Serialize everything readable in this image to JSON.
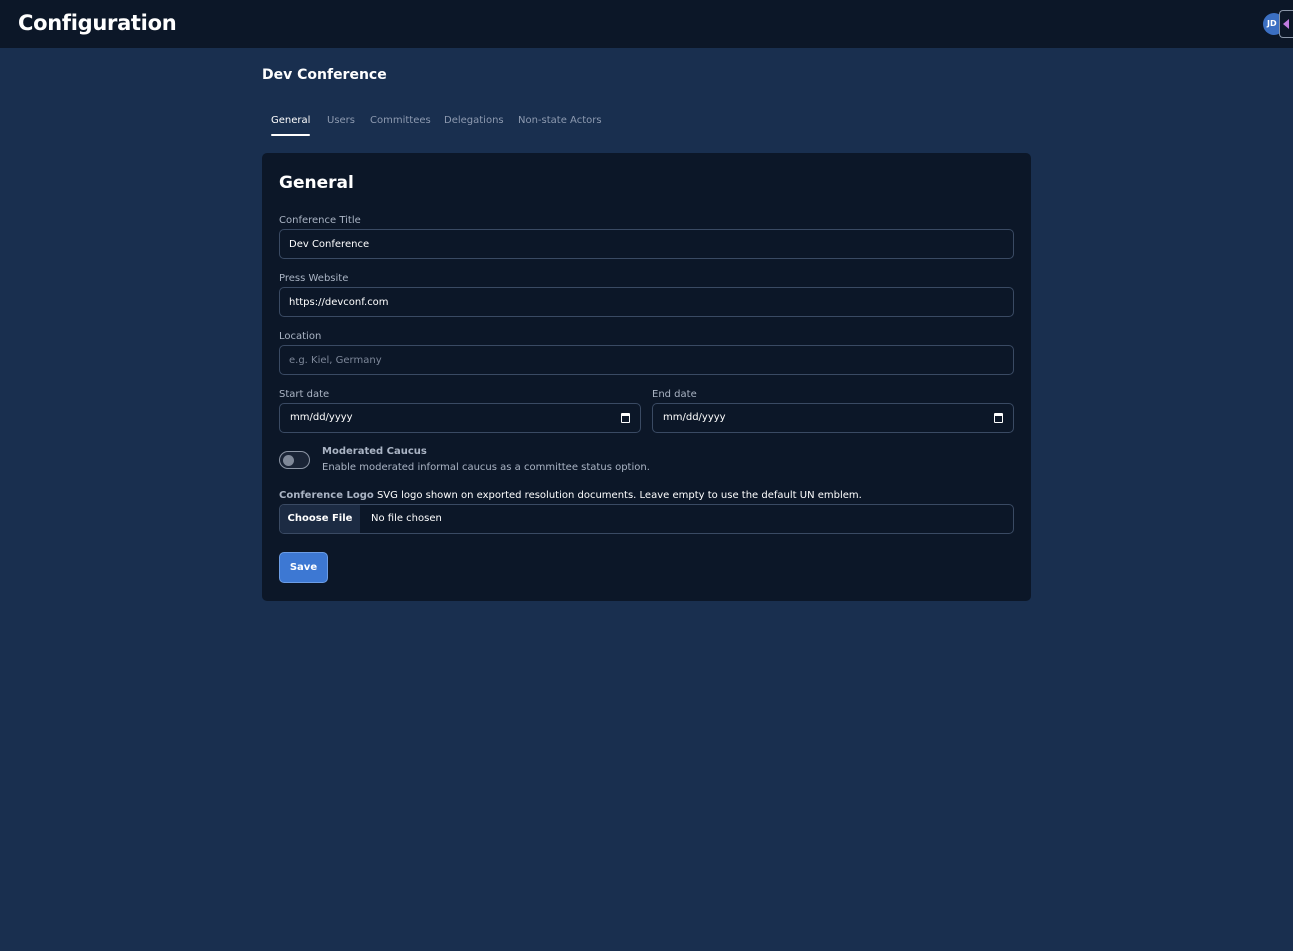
{
  "header": {
    "title": "Configuration",
    "avatar_initials": "JD"
  },
  "conference": {
    "name": "Dev Conference"
  },
  "tabs": [
    {
      "label": "General",
      "active": true
    },
    {
      "label": "Users",
      "active": false
    },
    {
      "label": "Committees",
      "active": false
    },
    {
      "label": "Delegations",
      "active": false
    },
    {
      "label": "Non-state Actors",
      "active": false
    }
  ],
  "form": {
    "title": "General",
    "conference_title": {
      "label": "Conference Title",
      "value": "Dev Conference"
    },
    "press_website": {
      "label": "Press Website",
      "value": "https://devconf.com"
    },
    "location": {
      "label": "Location",
      "value": "",
      "placeholder": "e.g. Kiel, Germany"
    },
    "start_date": {
      "label": "Start date",
      "value": "mm/dd/yyyy"
    },
    "end_date": {
      "label": "End date",
      "value": "mm/dd/yyyy"
    },
    "moderated_caucus": {
      "title": "Moderated Caucus",
      "description": "Enable moderated informal caucus as a committee status option.",
      "enabled": false
    },
    "logo": {
      "label": "Conference Logo",
      "hint": "SVG logo shown on exported resolution documents. Leave empty to use the default UN emblem.",
      "button_label": "Choose File",
      "status": "No file chosen"
    },
    "save_label": "Save"
  },
  "colors": {
    "page_bg": "#192f4f",
    "header_bg": "#0c1728",
    "card_bg": "#0c1728",
    "accent": "#3d78d3"
  }
}
